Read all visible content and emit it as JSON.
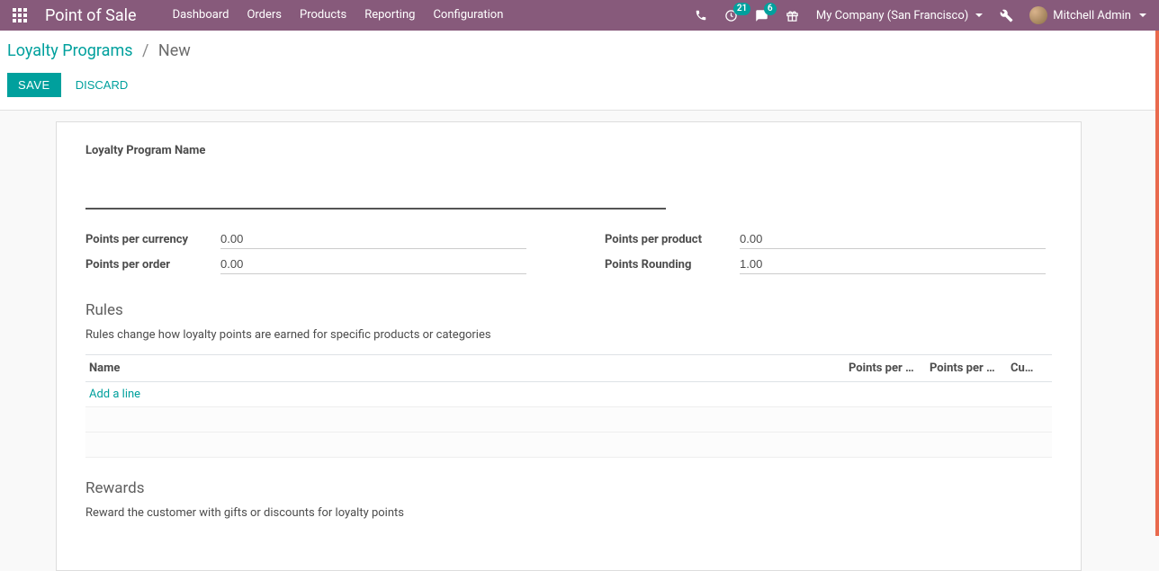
{
  "topbar": {
    "brand": "Point of Sale",
    "menu": [
      "Dashboard",
      "Orders",
      "Products",
      "Reporting",
      "Configuration"
    ],
    "clock_badge": "21",
    "chat_badge": "6",
    "company": "My Company (San Francisco)",
    "user": "Mitchell Admin"
  },
  "breadcrumb": {
    "parent": "Loyalty Programs",
    "current": "New"
  },
  "buttons": {
    "save": "SAVE",
    "discard": "DISCARD"
  },
  "form": {
    "title_label": "Loyalty Program Name",
    "title_value": "",
    "fields": {
      "points_per_currency_label": "Points per currency",
      "points_per_currency_value": "0.00",
      "points_per_order_label": "Points per order",
      "points_per_order_value": "0.00",
      "points_per_product_label": "Points per product",
      "points_per_product_value": "0.00",
      "points_rounding_label": "Points Rounding",
      "points_rounding_value": "1.00"
    },
    "rules": {
      "title": "Rules",
      "desc": "Rules change how loyalty points are earned for specific products or categories",
      "columns": [
        "Name",
        "Points per …",
        "Points per …",
        "Cu…"
      ],
      "add_line": "Add a line"
    },
    "rewards": {
      "title": "Rewards",
      "desc": "Reward the customer with gifts or discounts for loyalty points"
    }
  }
}
